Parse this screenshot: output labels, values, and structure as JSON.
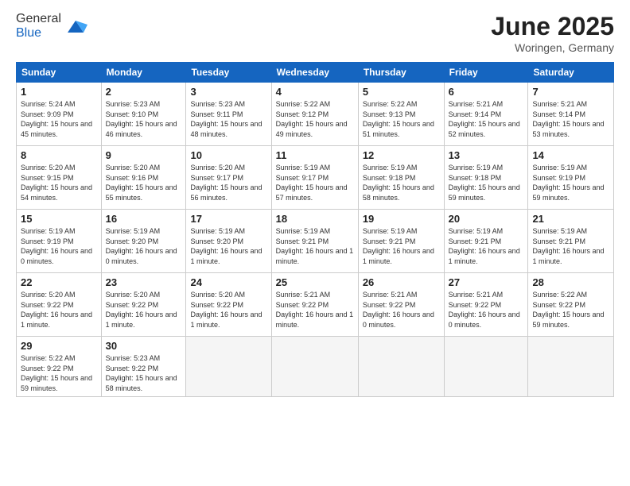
{
  "header": {
    "logo_general": "General",
    "logo_blue": "Blue",
    "month_title": "June 2025",
    "location": "Woringen, Germany"
  },
  "calendar": {
    "days_of_week": [
      "Sunday",
      "Monday",
      "Tuesday",
      "Wednesday",
      "Thursday",
      "Friday",
      "Saturday"
    ],
    "weeks": [
      [
        null,
        null,
        null,
        null,
        null,
        null,
        null
      ]
    ],
    "cells": [
      [
        {
          "day": null,
          "info": null
        },
        {
          "day": null,
          "info": null
        },
        {
          "day": null,
          "info": null
        },
        {
          "day": null,
          "info": null
        },
        {
          "day": null,
          "info": null
        },
        {
          "day": null,
          "info": null
        },
        {
          "day": null,
          "info": null
        }
      ]
    ],
    "rows": [
      {
        "cells": [
          {
            "num": "1",
            "sunrise": "Sunrise: 5:24 AM",
            "sunset": "Sunset: 9:09 PM",
            "daylight": "Daylight: 15 hours and 45 minutes."
          },
          {
            "num": "2",
            "sunrise": "Sunrise: 5:23 AM",
            "sunset": "Sunset: 9:10 PM",
            "daylight": "Daylight: 15 hours and 46 minutes."
          },
          {
            "num": "3",
            "sunrise": "Sunrise: 5:23 AM",
            "sunset": "Sunset: 9:11 PM",
            "daylight": "Daylight: 15 hours and 48 minutes."
          },
          {
            "num": "4",
            "sunrise": "Sunrise: 5:22 AM",
            "sunset": "Sunset: 9:12 PM",
            "daylight": "Daylight: 15 hours and 49 minutes."
          },
          {
            "num": "5",
            "sunrise": "Sunrise: 5:22 AM",
            "sunset": "Sunset: 9:13 PM",
            "daylight": "Daylight: 15 hours and 51 minutes."
          },
          {
            "num": "6",
            "sunrise": "Sunrise: 5:21 AM",
            "sunset": "Sunset: 9:14 PM",
            "daylight": "Daylight: 15 hours and 52 minutes."
          },
          {
            "num": "7",
            "sunrise": "Sunrise: 5:21 AM",
            "sunset": "Sunset: 9:14 PM",
            "daylight": "Daylight: 15 hours and 53 minutes."
          }
        ]
      },
      {
        "cells": [
          {
            "num": "8",
            "sunrise": "Sunrise: 5:20 AM",
            "sunset": "Sunset: 9:15 PM",
            "daylight": "Daylight: 15 hours and 54 minutes."
          },
          {
            "num": "9",
            "sunrise": "Sunrise: 5:20 AM",
            "sunset": "Sunset: 9:16 PM",
            "daylight": "Daylight: 15 hours and 55 minutes."
          },
          {
            "num": "10",
            "sunrise": "Sunrise: 5:20 AM",
            "sunset": "Sunset: 9:17 PM",
            "daylight": "Daylight: 15 hours and 56 minutes."
          },
          {
            "num": "11",
            "sunrise": "Sunrise: 5:19 AM",
            "sunset": "Sunset: 9:17 PM",
            "daylight": "Daylight: 15 hours and 57 minutes."
          },
          {
            "num": "12",
            "sunrise": "Sunrise: 5:19 AM",
            "sunset": "Sunset: 9:18 PM",
            "daylight": "Daylight: 15 hours and 58 minutes."
          },
          {
            "num": "13",
            "sunrise": "Sunrise: 5:19 AM",
            "sunset": "Sunset: 9:18 PM",
            "daylight": "Daylight: 15 hours and 59 minutes."
          },
          {
            "num": "14",
            "sunrise": "Sunrise: 5:19 AM",
            "sunset": "Sunset: 9:19 PM",
            "daylight": "Daylight: 15 hours and 59 minutes."
          }
        ]
      },
      {
        "cells": [
          {
            "num": "15",
            "sunrise": "Sunrise: 5:19 AM",
            "sunset": "Sunset: 9:19 PM",
            "daylight": "Daylight: 16 hours and 0 minutes."
          },
          {
            "num": "16",
            "sunrise": "Sunrise: 5:19 AM",
            "sunset": "Sunset: 9:20 PM",
            "daylight": "Daylight: 16 hours and 0 minutes."
          },
          {
            "num": "17",
            "sunrise": "Sunrise: 5:19 AM",
            "sunset": "Sunset: 9:20 PM",
            "daylight": "Daylight: 16 hours and 1 minute."
          },
          {
            "num": "18",
            "sunrise": "Sunrise: 5:19 AM",
            "sunset": "Sunset: 9:21 PM",
            "daylight": "Daylight: 16 hours and 1 minute."
          },
          {
            "num": "19",
            "sunrise": "Sunrise: 5:19 AM",
            "sunset": "Sunset: 9:21 PM",
            "daylight": "Daylight: 16 hours and 1 minute."
          },
          {
            "num": "20",
            "sunrise": "Sunrise: 5:19 AM",
            "sunset": "Sunset: 9:21 PM",
            "daylight": "Daylight: 16 hours and 1 minute."
          },
          {
            "num": "21",
            "sunrise": "Sunrise: 5:19 AM",
            "sunset": "Sunset: 9:21 PM",
            "daylight": "Daylight: 16 hours and 1 minute."
          }
        ]
      },
      {
        "cells": [
          {
            "num": "22",
            "sunrise": "Sunrise: 5:20 AM",
            "sunset": "Sunset: 9:22 PM",
            "daylight": "Daylight: 16 hours and 1 minute."
          },
          {
            "num": "23",
            "sunrise": "Sunrise: 5:20 AM",
            "sunset": "Sunset: 9:22 PM",
            "daylight": "Daylight: 16 hours and 1 minute."
          },
          {
            "num": "24",
            "sunrise": "Sunrise: 5:20 AM",
            "sunset": "Sunset: 9:22 PM",
            "daylight": "Daylight: 16 hours and 1 minute."
          },
          {
            "num": "25",
            "sunrise": "Sunrise: 5:21 AM",
            "sunset": "Sunset: 9:22 PM",
            "daylight": "Daylight: 16 hours and 1 minute."
          },
          {
            "num": "26",
            "sunrise": "Sunrise: 5:21 AM",
            "sunset": "Sunset: 9:22 PM",
            "daylight": "Daylight: 16 hours and 0 minutes."
          },
          {
            "num": "27",
            "sunrise": "Sunrise: 5:21 AM",
            "sunset": "Sunset: 9:22 PM",
            "daylight": "Daylight: 16 hours and 0 minutes."
          },
          {
            "num": "28",
            "sunrise": "Sunrise: 5:22 AM",
            "sunset": "Sunset: 9:22 PM",
            "daylight": "Daylight: 15 hours and 59 minutes."
          }
        ]
      },
      {
        "cells": [
          {
            "num": "29",
            "sunrise": "Sunrise: 5:22 AM",
            "sunset": "Sunset: 9:22 PM",
            "daylight": "Daylight: 15 hours and 59 minutes."
          },
          {
            "num": "30",
            "sunrise": "Sunrise: 5:23 AM",
            "sunset": "Sunset: 9:22 PM",
            "daylight": "Daylight: 15 hours and 58 minutes."
          },
          null,
          null,
          null,
          null,
          null
        ]
      }
    ]
  }
}
